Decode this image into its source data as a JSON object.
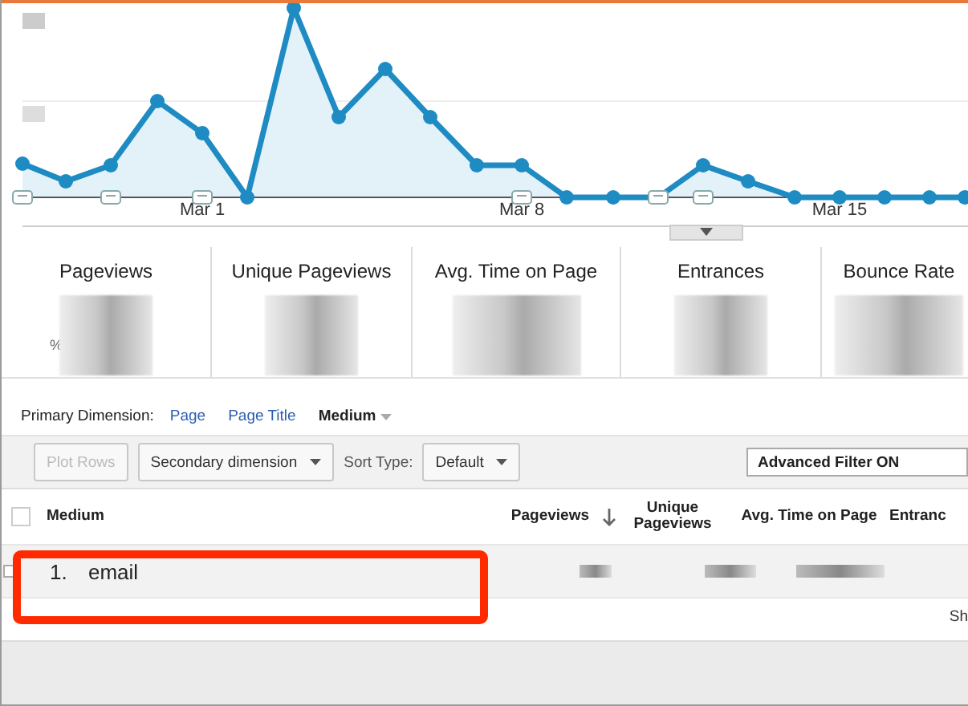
{
  "chart": {
    "x_labels": [
      "Mar 1",
      "Mar 8",
      "Mar 15"
    ]
  },
  "metrics": [
    {
      "label": "Pageviews",
      "note": "%"
    },
    {
      "label": "Unique Pageviews"
    },
    {
      "label": "Avg. Time on Page"
    },
    {
      "label": "Entrances"
    },
    {
      "label": "Bounce Rate"
    }
  ],
  "primary_dimension": {
    "label": "Primary Dimension:",
    "options": [
      {
        "label": "Page",
        "selected": false
      },
      {
        "label": "Page Title",
        "selected": false
      },
      {
        "label": "Medium",
        "selected": true
      }
    ]
  },
  "toolbar": {
    "plot_rows": {
      "label": "Plot Rows",
      "disabled": true
    },
    "secondary_dimension": "Secondary dimension",
    "sort_type_label": "Sort Type:",
    "sort_type": "Default",
    "filter": "Advanced Filter ON"
  },
  "table": {
    "select_all": {
      "checked": false
    },
    "columns": [
      {
        "label": "Medium",
        "sorted": false
      },
      {
        "label": "Pageviews",
        "sorted": true
      },
      {
        "label": "Unique Pageviews",
        "sorted": false
      },
      {
        "label": "Avg. Time on Page",
        "sorted": false
      },
      {
        "label": "Entranc",
        "sorted": false
      }
    ],
    "rows": [
      {
        "index": "1.",
        "medium": "email",
        "highlighted": true,
        "checked": false
      }
    ]
  },
  "footer": {
    "text": "Sh"
  }
}
